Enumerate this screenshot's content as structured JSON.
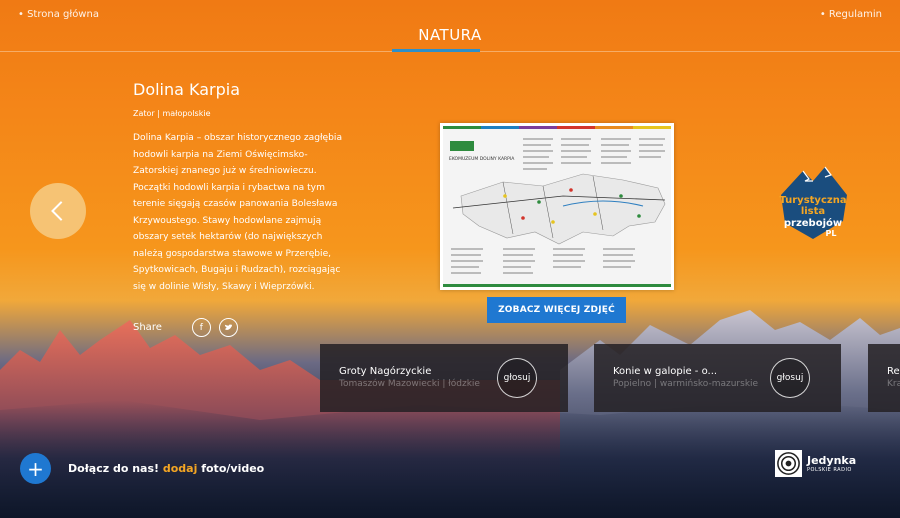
{
  "nav": {
    "home_link": "• Strona główna",
    "rules_link": "• Regulamin",
    "category": "NATURA"
  },
  "article": {
    "title": "Dolina Karpia",
    "location": "Zator | małopolskie",
    "description": "Dolina Karpia – obszar historycznego zagłębia hodowli karpia na Ziemi Oświęcimsko-Zatorskiej znanego już w średniowieczu. Początki hodowli karpia i rybactwa na tym terenie sięgają czasów panowania Bolesława Krzywoustego. Stawy hodowlane zajmują obszary setek hektarów (do największych należą gospodarstwa stawowe w Przerębie, Spytkowicach, Bugaju i Rudzach), rozciągając się w dolinie Wisły, Skawy i Wieprzówki. \"Dolina Karpia\" to",
    "share_label": "Share",
    "more_photos_label": "ZOBACZ WIĘCEJ ZDJĘĆ",
    "photo_title": "EKOMUZEUM DOLINY KARPIA"
  },
  "badge": {
    "line1": "Turystyczna",
    "line2": "lista",
    "line3": "przebojów",
    "line4": "PL"
  },
  "cards": [
    {
      "title": "Groty Nagórzyckie",
      "subtitle": "Tomaszów Mazowiecki | łódzkie",
      "vote_label": "głosuj"
    },
    {
      "title": "Konie w galopie - o...",
      "subtitle": "Popielno | warmińsko-mazurskie",
      "vote_label": "głosuj"
    },
    {
      "title": "Rez",
      "subtitle": "Kra",
      "vote_label": ""
    }
  ],
  "footer": {
    "add_icon": "+",
    "join_text": "Dołącz do nas!",
    "join_highlight": "dodaj",
    "join_suffix": "foto/video",
    "logo_name": "Jedynka",
    "logo_small": "POLSKIE RADIO"
  },
  "colors": {
    "accent_blue": "#1f78d1",
    "highlight_orange": "#f5a623",
    "underline_blue": "#2e8fc8"
  }
}
